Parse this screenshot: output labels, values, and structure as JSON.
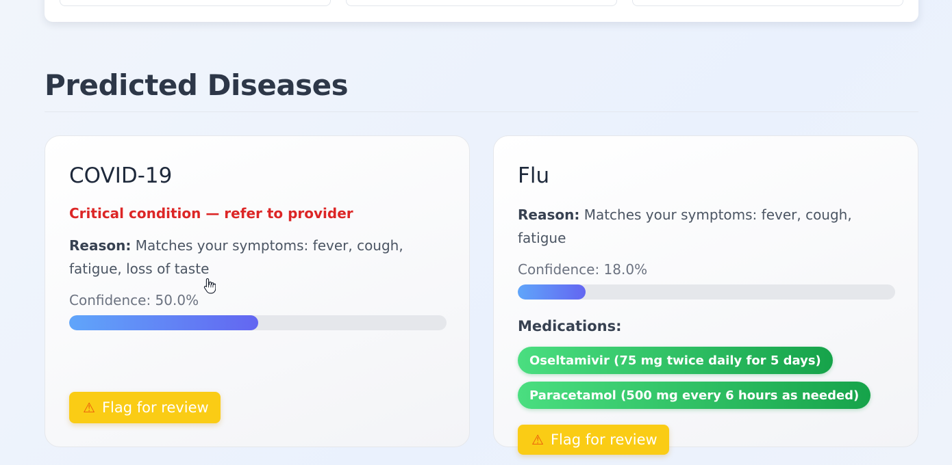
{
  "section": {
    "title": "Predicted Diseases"
  },
  "predictions": [
    {
      "name": "COVID-19",
      "alert": "Critical condition — refer to provider",
      "reason_label": "Reason:",
      "reason_text": "Matches your symptoms: fever, cough, fatigue, loss of taste",
      "confidence_text": "Confidence: 50.0%",
      "confidence_value": 0.5,
      "flag_label": "Flag for review"
    },
    {
      "name": "Flu",
      "reason_label": "Reason:",
      "reason_text": "Matches your symptoms: fever, cough, fatigue",
      "confidence_text": "Confidence: 18.0%",
      "confidence_value": 0.18,
      "medications_label": "Medications:",
      "medications": [
        "Oseltamivir (75 mg twice daily for 5 days)",
        "Paracetamol (500 mg every 6 hours as needed)"
      ],
      "flag_label": "Flag for review"
    }
  ],
  "icons": {
    "flag": "warning-icon",
    "cursor": "hand-pointer-icon"
  },
  "colors": {
    "accent_bar_start": "#60a5fa",
    "accent_bar_end": "#6366f1",
    "critical": "#dc2626",
    "medication": "#22c55e",
    "flag": "#facc15"
  }
}
